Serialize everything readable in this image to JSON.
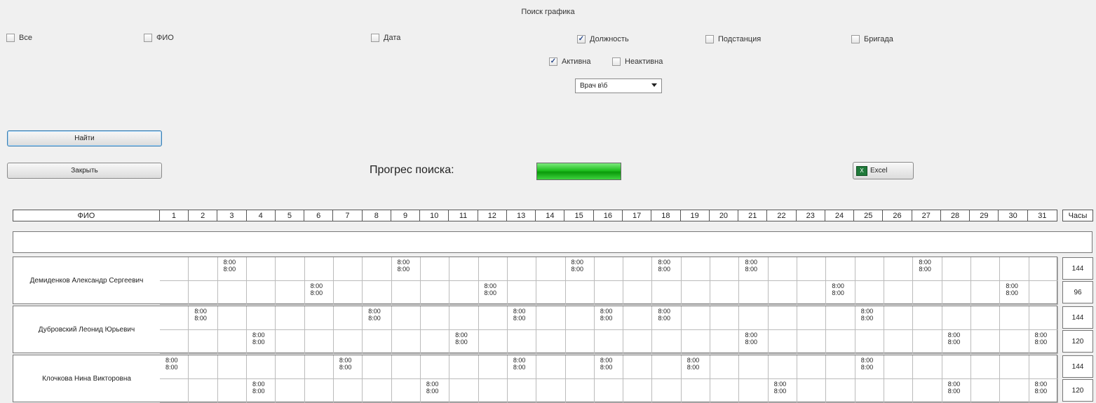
{
  "window": {
    "title": "Поиск графика"
  },
  "filters": {
    "all": {
      "label": "Все",
      "checked": false
    },
    "fio": {
      "label": "ФИО",
      "checked": false
    },
    "date": {
      "label": "Дата",
      "checked": false
    },
    "position": {
      "label": "Должность",
      "checked": true
    },
    "substation": {
      "label": "Подстанция",
      "checked": false
    },
    "brigade": {
      "label": "Бригада",
      "checked": false
    },
    "active": {
      "label": "Активна",
      "checked": true
    },
    "inactive": {
      "label": "Неактивна",
      "checked": false
    },
    "position_select": {
      "value": "Врач в\\б"
    }
  },
  "buttons": {
    "find": "Найти",
    "close": "Закрыть",
    "excel": "Excel"
  },
  "progress": {
    "label": "Прогрес поиска:",
    "value": 100,
    "color": "#1fbf1f"
  },
  "table": {
    "name_header": "ФИО",
    "days": [
      "1",
      "2",
      "3",
      "4",
      "5",
      "6",
      "7",
      "8",
      "9",
      "10",
      "11",
      "12",
      "13",
      "14",
      "15",
      "16",
      "17",
      "18",
      "19",
      "20",
      "21",
      "22",
      "23",
      "24",
      "25",
      "26",
      "27",
      "28",
      "29",
      "30",
      "31"
    ],
    "hours_header": "Часы",
    "shift_line1": "8:00",
    "shift_line2": "8:00",
    "people": [
      {
        "name": "Демиденков Александр Сергеевич",
        "rows": [
          {
            "days": [
              3,
              9,
              15,
              18,
              21,
              27
            ],
            "hours": "144"
          },
          {
            "days": [
              6,
              12,
              24,
              30
            ],
            "hours": "96"
          }
        ]
      },
      {
        "name": "Дубровский Леонид Юрьевич",
        "rows": [
          {
            "days": [
              2,
              8,
              13,
              16,
              18,
              25
            ],
            "hours": "144"
          },
          {
            "days": [
              4,
              11,
              21,
              28,
              31
            ],
            "hours": "120"
          }
        ]
      },
      {
        "name": "Клочкова Нина Викторовна",
        "rows": [
          {
            "days": [
              1,
              7,
              13,
              16,
              19,
              25
            ],
            "hours": "144"
          },
          {
            "days": [
              4,
              10,
              22,
              28,
              31
            ],
            "hours": "120"
          }
        ]
      }
    ]
  }
}
